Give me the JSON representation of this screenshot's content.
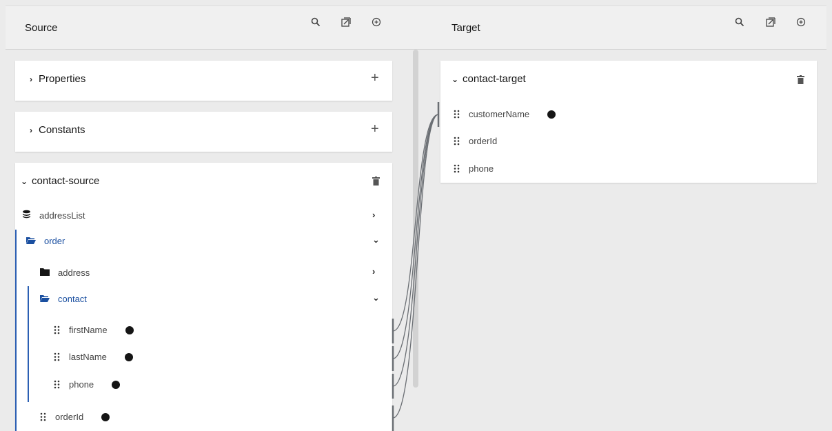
{
  "source": {
    "title": "Source",
    "icons": [
      "search-icon",
      "import-icon",
      "add-circle-icon"
    ],
    "properties": {
      "label": "Properties"
    },
    "constants": {
      "label": "Constants"
    },
    "document": {
      "label": "contact-source",
      "items": {
        "addressList": "addressList",
        "order": "order",
        "address": "address",
        "contact": "contact",
        "firstName": "firstName",
        "lastName": "lastName",
        "phone": "phone",
        "orderId": "orderId"
      }
    }
  },
  "target": {
    "title": "Target",
    "icons": [
      "search-icon",
      "import-icon",
      "add-circle-icon"
    ],
    "document": {
      "label": "contact-target",
      "items": {
        "customerName": "customerName",
        "orderId": "orderId",
        "phone": "phone"
      }
    }
  },
  "colors": {
    "accent": "#1a4fa0",
    "background": "#ebebeb",
    "mapped_dot": "#151515",
    "connector": "#6a6e73"
  }
}
